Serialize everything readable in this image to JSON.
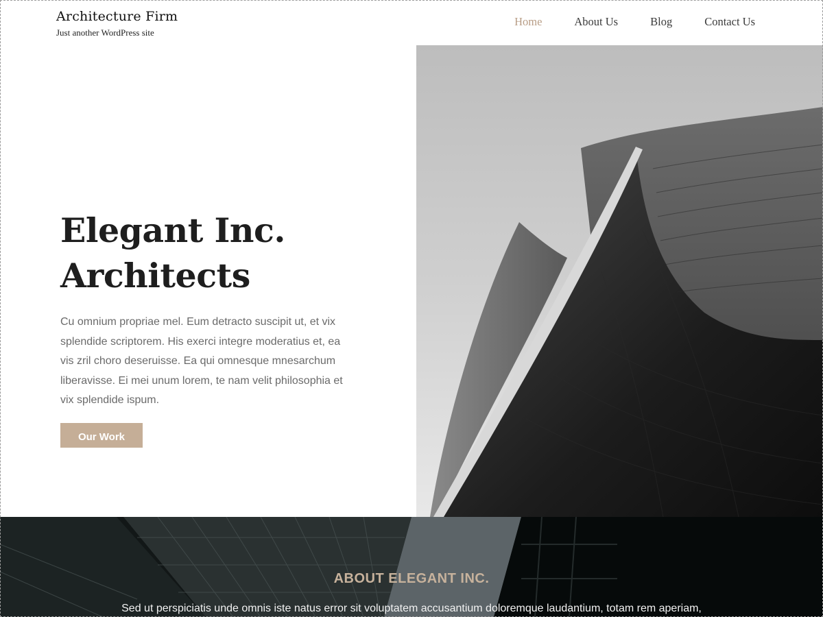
{
  "header": {
    "site_title": "Architecture Firm",
    "tagline": "Just another WordPress site",
    "nav": [
      {
        "label": "Home",
        "active": true
      },
      {
        "label": "About Us",
        "active": false
      },
      {
        "label": "Blog",
        "active": false
      },
      {
        "label": "Contact Us",
        "active": false
      }
    ]
  },
  "hero": {
    "title_line1": "Elegant Inc.",
    "title_line2": "Architects",
    "body": "Cu omnium propriae mel. Eum detracto suscipit ut, et vix splendide scriptorem. His exerci integre moderatius et, ea vis zril choro deseruisse. Ea qui omnesque mnesarchum liberavisse. Ei mei unum lorem, te nam velit philosophia et vix splendide ispum.",
    "button_label": "Our Work",
    "image": "architecture-building-photo"
  },
  "about": {
    "heading": "ABOUT ELEGANT INC.",
    "text": "Sed ut perspiciatis unde omnis iste natus error sit voluptatem accusantium doloremque laudantium, totam rem aperiam,",
    "background_image": "skyscrapers-photo"
  },
  "colors": {
    "accent": "#c5ae97",
    "nav_active": "#b89d86",
    "about_heading": "#c7b29c",
    "text_dark": "#1e1e1e",
    "text_muted": "#6a6a6a"
  }
}
